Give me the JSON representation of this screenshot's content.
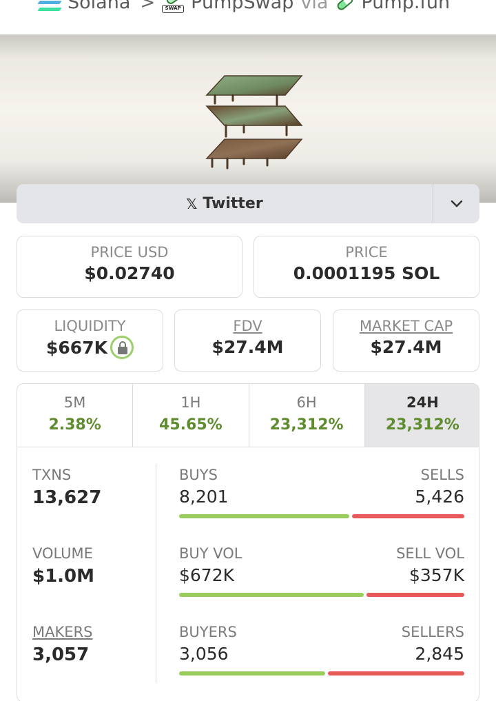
{
  "breadcrumb": {
    "chain": "Solana",
    "separator": ">",
    "dex": "PumpSwap",
    "dex_tag": "SWAP",
    "via": "via",
    "launchpad": "Pump.fun"
  },
  "social": {
    "twitter_label": "Twitter",
    "twitter_icon": "x-logo-icon",
    "dropdown_icon": "chevron-down-icon"
  },
  "price": {
    "usd_label": "PRICE USD",
    "usd_value": "$0.02740",
    "native_label": "PRICE",
    "native_value": "0.0001195 SOL"
  },
  "metrics": {
    "liquidity_label": "LIQUIDITY",
    "liquidity_value": "$667K",
    "fdv_label": "FDV",
    "fdv_value": "$27.4M",
    "mcap_label": "MARKET CAP",
    "mcap_value": "$27.4M"
  },
  "timeframes": [
    {
      "label": "5M",
      "change": "2.38%"
    },
    {
      "label": "1H",
      "change": "45.65%"
    },
    {
      "label": "6H",
      "change": "23,312%"
    },
    {
      "label": "24H",
      "change": "23,312%",
      "active": true
    }
  ],
  "stats": {
    "txns_label": "TXNS",
    "txns_value": "13,627",
    "volume_label": "VOLUME",
    "volume_value": "$1.0M",
    "makers_label": "MAKERS",
    "makers_value": "3,057",
    "buys_label": "BUYS",
    "buys_value": "8,201",
    "sells_label": "SELLS",
    "sells_value": "5,426",
    "buyvol_label": "BUY VOL",
    "buyvol_value": "$672K",
    "sellvol_label": "SELL VOL",
    "sellvol_value": "$357K",
    "buyers_label": "BUYERS",
    "buyers_value": "3,056",
    "sellers_label": "SELLERS",
    "sellers_value": "2,845",
    "buys_share": 0.602,
    "buyvol_share": 0.653,
    "buyers_share": 0.518
  },
  "colors": {
    "positive": "#5e8c2e",
    "buy_bar": "#99cc5c",
    "sell_bar": "#e85a5a"
  }
}
